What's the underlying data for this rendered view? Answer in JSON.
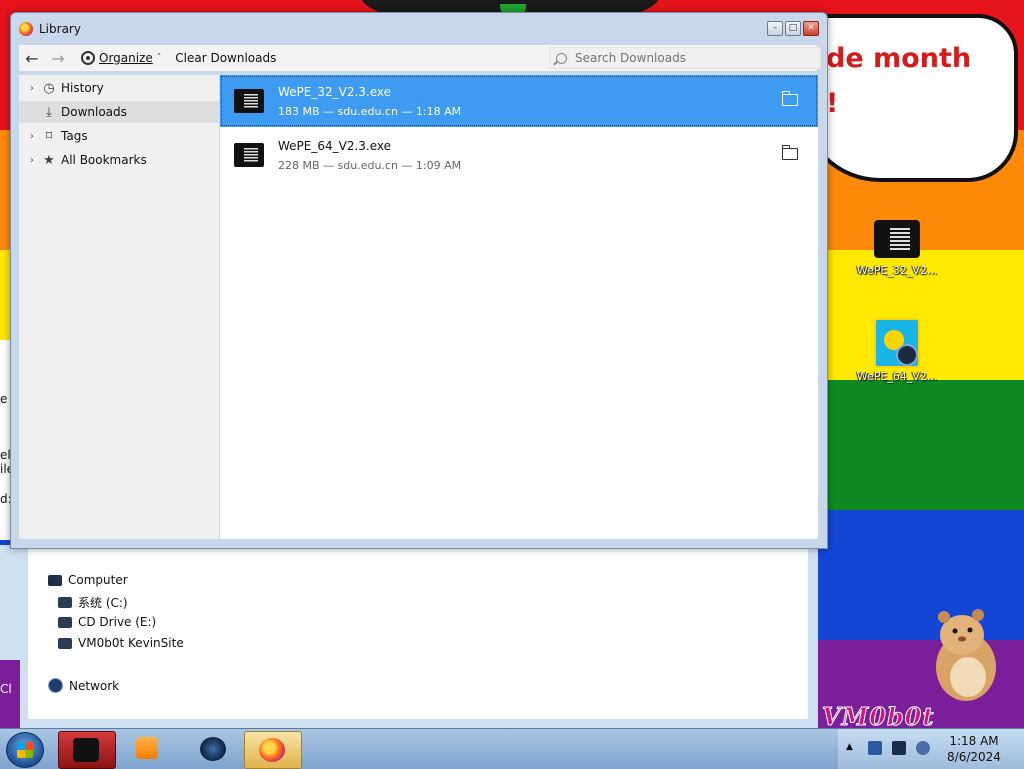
{
  "window": {
    "title": "Library",
    "controls": {
      "minimize": "–",
      "maximize": "□",
      "close": "✕"
    }
  },
  "toolbar": {
    "back": "←",
    "forward": "→",
    "organize_label": "Organize",
    "organize_chevron": "˅",
    "clear_downloads_label": "Clear Downloads",
    "search_placeholder": "Search Downloads"
  },
  "sidebar": {
    "items": [
      {
        "label": "History",
        "icon": "clock-icon",
        "expandable": true,
        "selected": false
      },
      {
        "label": "Downloads",
        "icon": "download-icon",
        "expandable": false,
        "selected": true
      },
      {
        "label": "Tags",
        "icon": "tag-icon",
        "expandable": true,
        "selected": false
      },
      {
        "label": "All Bookmarks",
        "icon": "star-icon",
        "expandable": true,
        "selected": false
      }
    ]
  },
  "downloads": [
    {
      "name": "WePE_32_V2.3.exe",
      "meta": "183 MB — sdu.edu.cn — 1:18 AM",
      "selected": true
    },
    {
      "name": "WePE_64_V2.3.exe",
      "meta": "228 MB — sdu.edu.cn — 1:09 AM",
      "selected": false
    }
  ],
  "desktop": {
    "banner_line1": "de month",
    "banner_line2": "!",
    "icons": [
      {
        "label": "WePE_32_V2...",
        "icon": "exe-icon"
      },
      {
        "label": "WePE_64_V2...",
        "icon": "wepe-icon"
      }
    ],
    "watermark": "VM0b0t"
  },
  "explorer": {
    "tree": [
      {
        "label": "Computer",
        "icon": "computer-icon"
      },
      {
        "label": "系统 (C:)",
        "icon": "drive-icon"
      },
      {
        "label": "CD Drive (E:)",
        "icon": "cd-drive-icon"
      },
      {
        "label": "VM0b0t KevinSite",
        "icon": "network-drive-icon"
      },
      {
        "label": "Network",
        "icon": "network-icon"
      }
    ],
    "left_fragments": [
      "e",
      "el",
      "ile",
      "d:",
      "Cl"
    ]
  },
  "taskbar": {
    "time": "1:18 AM",
    "date": "8/6/2024",
    "tray_chevron": "▲"
  },
  "colors": {
    "selection": "#3d9bf2",
    "wallpaper": [
      "#e8141b",
      "#ff8a0a",
      "#ffe900",
      "#0d8a22",
      "#1446d6",
      "#7a1f99"
    ]
  }
}
